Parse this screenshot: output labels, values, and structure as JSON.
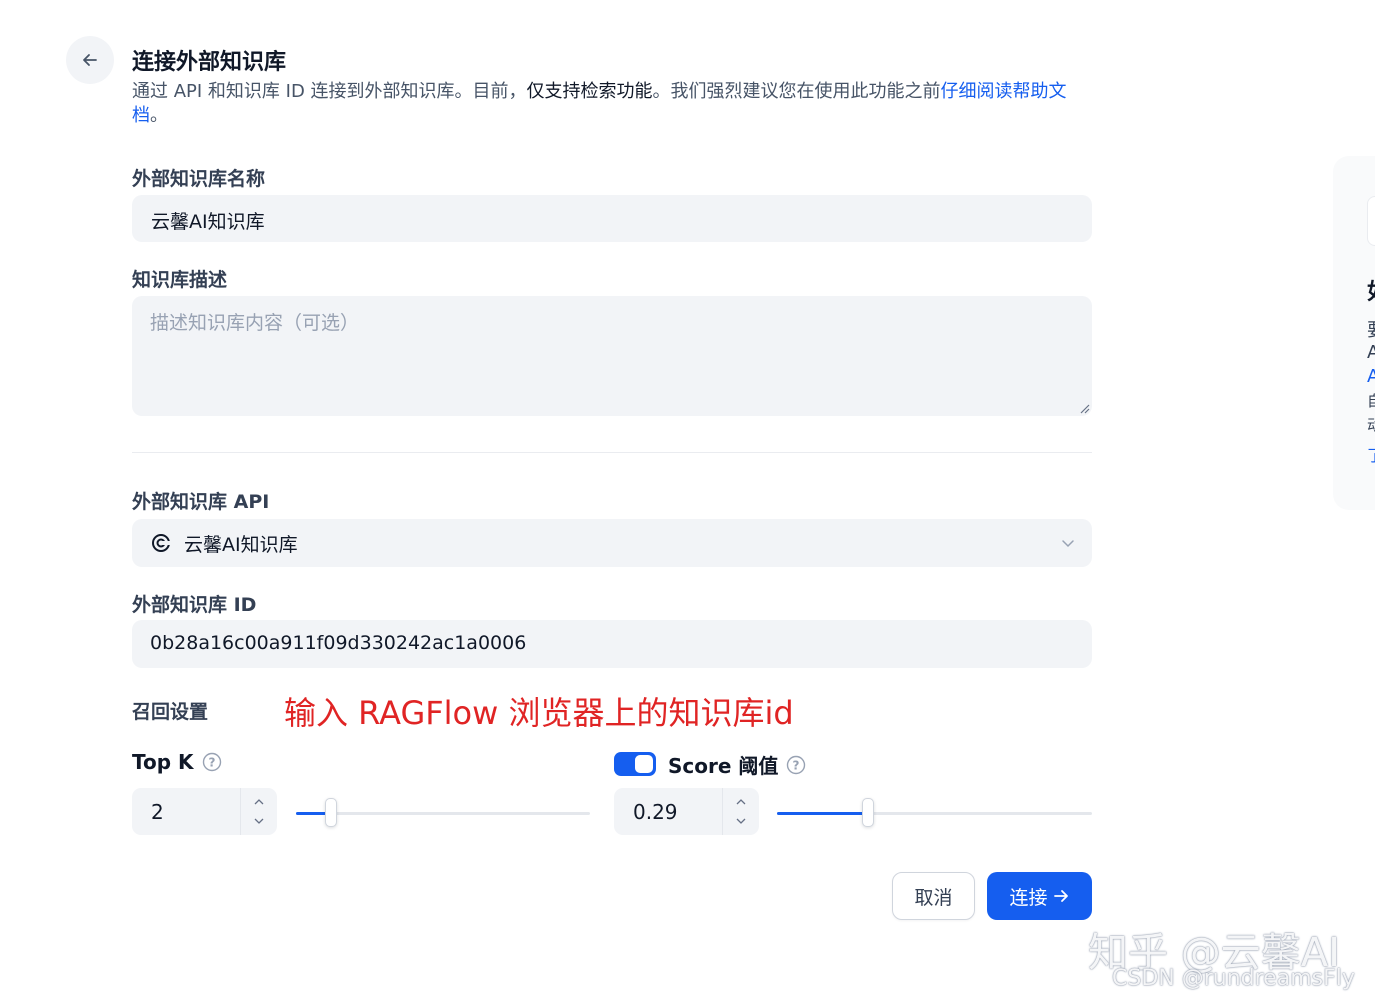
{
  "header": {
    "back_icon": "arrow-left-icon",
    "title": "连接外部知识库",
    "desc_part1": "通过 API 和知识库 ID 连接到外部知识库。目前，",
    "desc_strong": "仅支持检索功能",
    "desc_part2": "。我们强烈建议您在使用此功能之前",
    "desc_link": "仔细阅读帮助文档",
    "desc_end": "。"
  },
  "form": {
    "name_label": "外部知识库名称",
    "name_value": "云馨AI知识库",
    "desc_label": "知识库描述",
    "desc_placeholder": "描述知识库内容（可选）",
    "api_label": "外部知识库 API",
    "api_selected": "云馨AI知识库",
    "api_icon": "api-logo-icon",
    "id_label": "外部知识库 ID",
    "id_value": "0b28a16c00a911f09d330242ac1a0006"
  },
  "annotation": "输入 RAGFlow 浏览器上的知识库id",
  "retrieval": {
    "section_label": "召回设置",
    "topk_label": "Top K",
    "topk_value": "2",
    "topk_slider_fraction": 0.12,
    "score_label": "Score 阈值",
    "score_enabled": true,
    "score_value": "0.29",
    "score_slider_fraction": 0.29
  },
  "actions": {
    "cancel_label": "取消",
    "connect_label": "连接"
  },
  "side_panel": {
    "heading": "如",
    "lines": [
      "要",
      "A",
      "A",
      "自",
      "动",
      "了"
    ]
  },
  "watermark": {
    "zhihu": "知乎 @云馨AI",
    "csdn": "CSDN @rundreamsFly"
  },
  "colors": {
    "primary": "#155eef",
    "annotation": "#e02424",
    "input_bg": "#f2f4f7"
  }
}
